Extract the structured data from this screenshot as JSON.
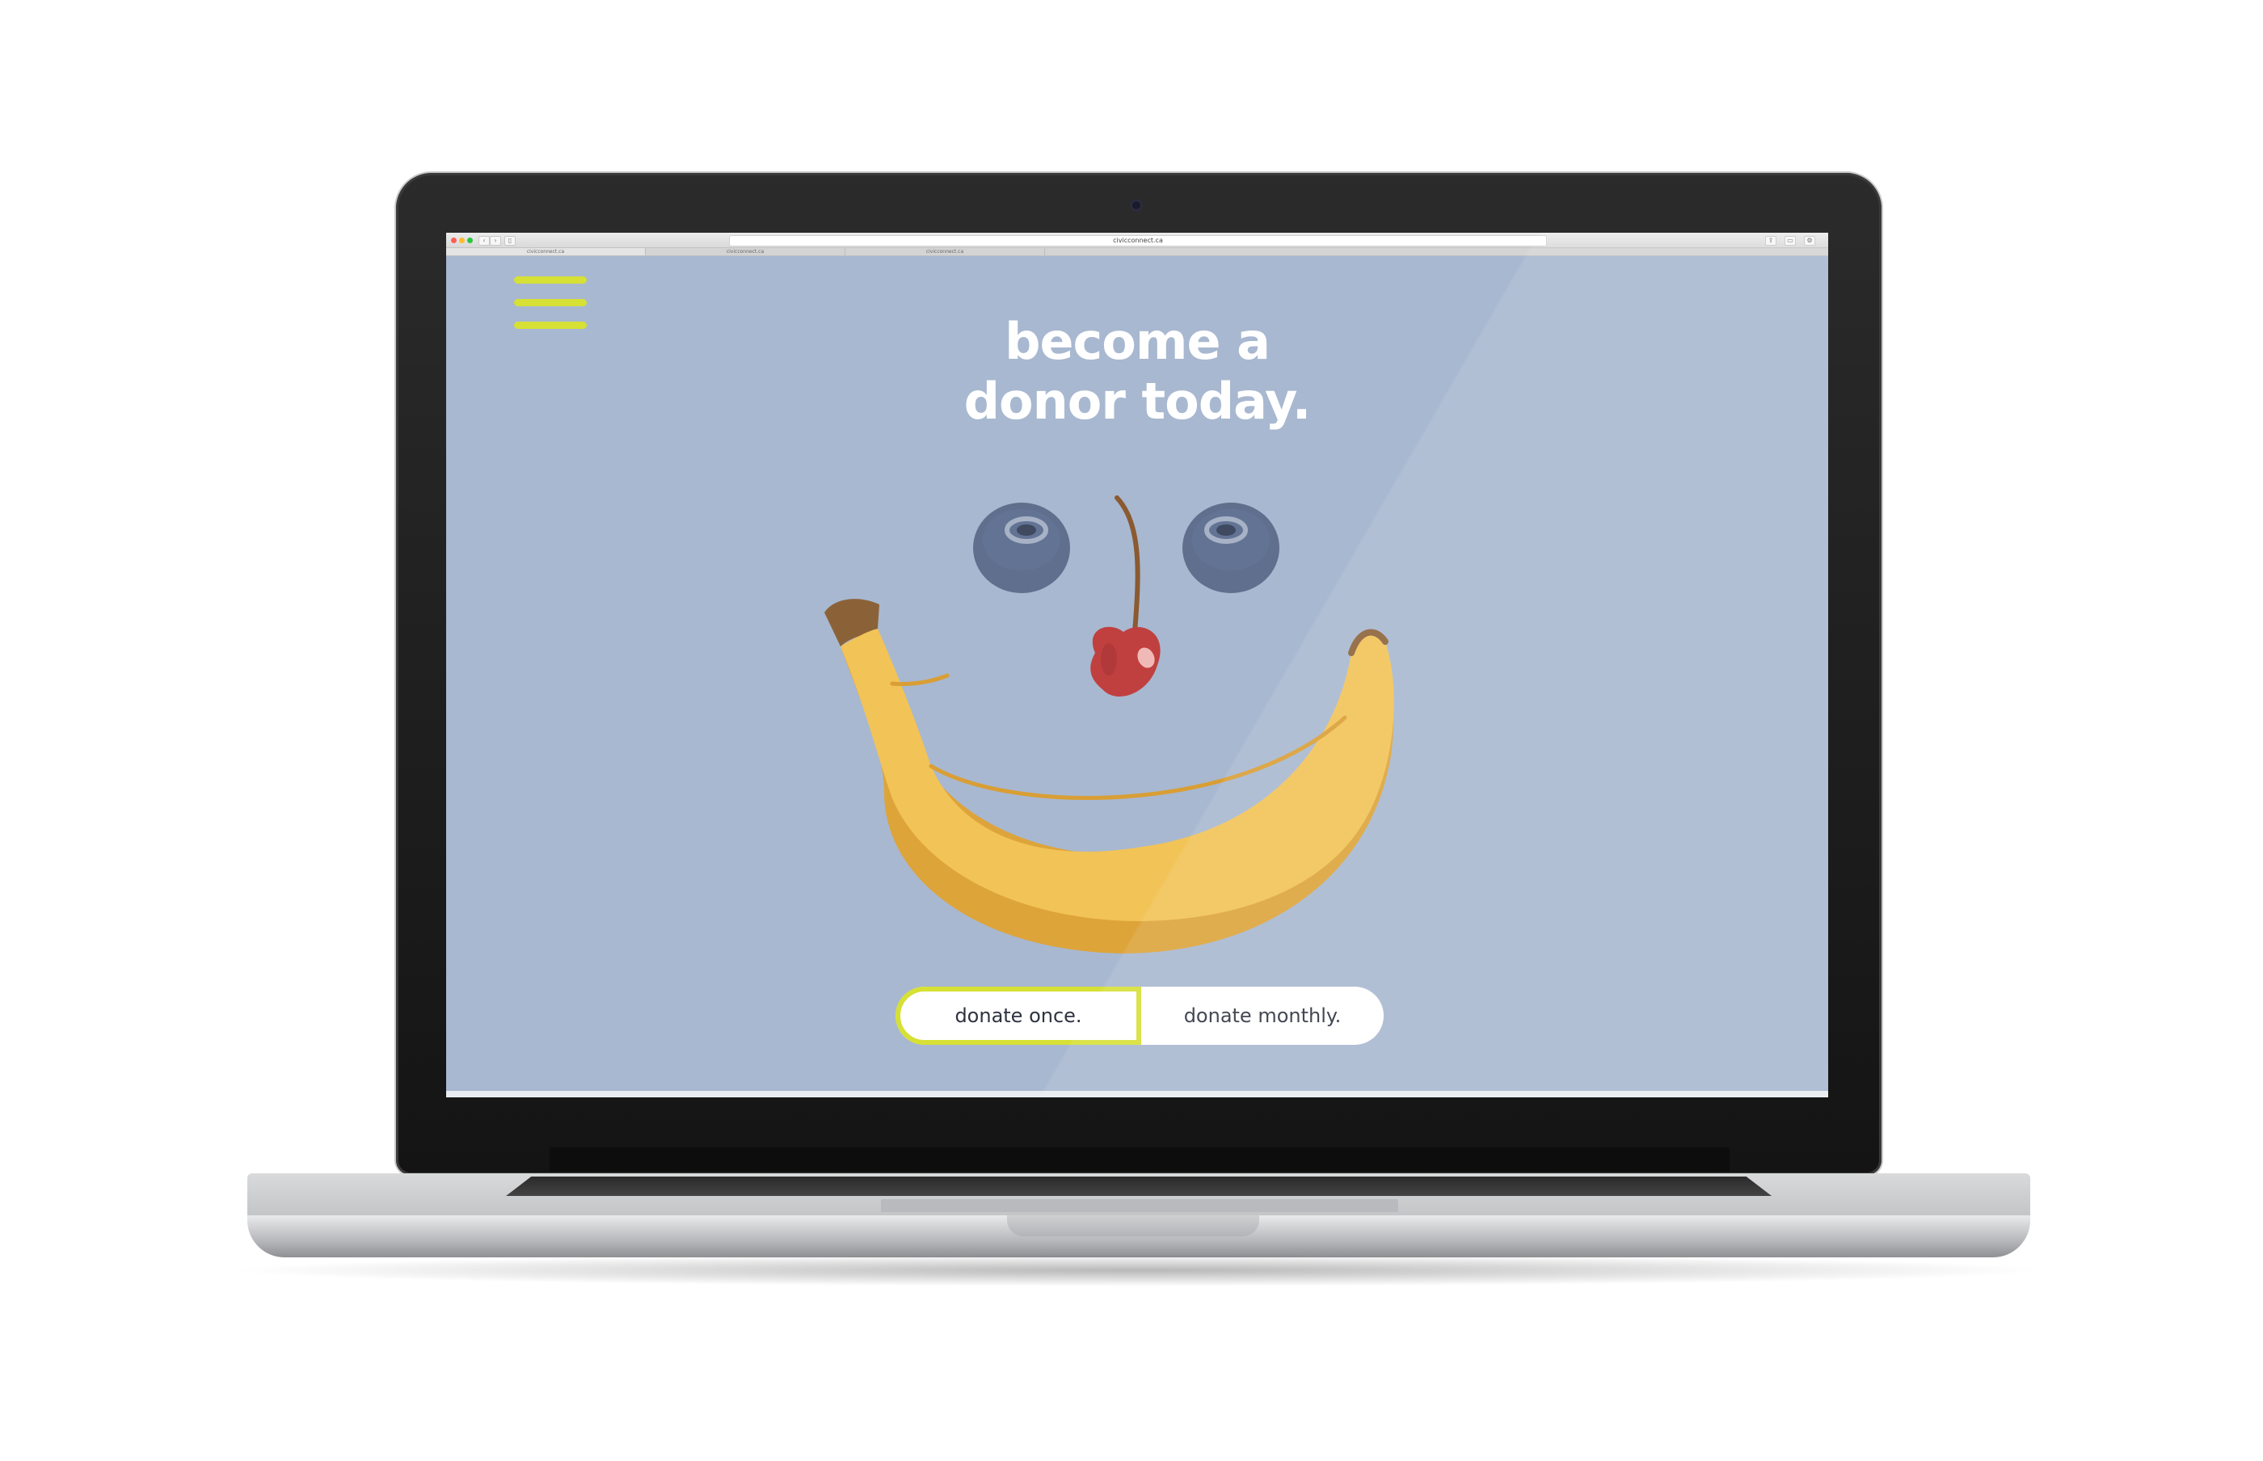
{
  "browser": {
    "url": "civicconnect.ca",
    "tabs": [
      "civicconnect.ca",
      "civicconnect.ca",
      "civicconnect.ca"
    ]
  },
  "page": {
    "headline_line1": "become a",
    "headline_line2": "donor today.",
    "donate_once": "donate once.",
    "donate_monthly": "donate monthly."
  },
  "colors": {
    "background": "#a8b8d0",
    "accent": "#d6e035",
    "banana": "#f2c357",
    "blueberry": "#5f6f8d",
    "cherry": "#c0403f"
  },
  "icons": {
    "menu": "hamburger-icon",
    "back": "chevron-left-icon",
    "forward": "chevron-right-icon"
  }
}
